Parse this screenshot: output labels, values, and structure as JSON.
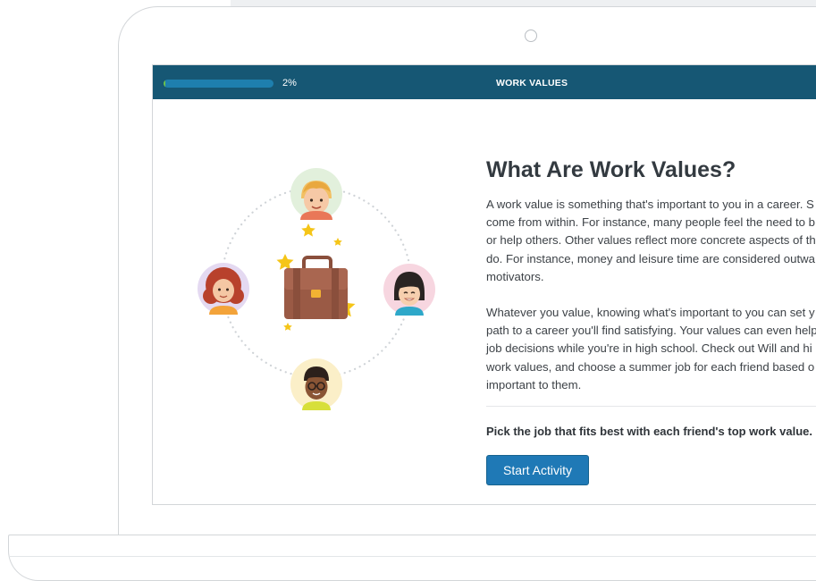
{
  "header": {
    "progress_percent": 2,
    "progress_label": "2%",
    "module_title": "WORK VALUES"
  },
  "main": {
    "title": "What Are Work Values?",
    "paragraph_1": "A work value is something that's important to you in a career. S\ncome from within. For instance, many people feel the need to b\nor help others. Other values reflect more concrete aspects of th\ndo. For instance, money and leisure time are considered outwa\nmotivators.",
    "paragraph_2": "Whatever you value, knowing what's important to you can set y\npath to a career you'll find satisfying. Your values can even help\njob decisions while you're in high school. Check out Will and hi\nwork values, and choose a summer job for each friend based o\nimportant to them.",
    "instruction": "Pick the job that fits best with each friend's top work value.",
    "start_button_label": "Start Activity"
  },
  "colors": {
    "header_bg": "#165774",
    "progress_track": "#1e7fae",
    "progress_fill": "#6cc24a",
    "button_bg": "#1f79b6",
    "briefcase": "#9a5a45",
    "star": "#f5c518"
  },
  "illustration": {
    "icons": [
      "avatar-blond-boy-icon",
      "avatar-red-hair-girl-icon",
      "avatar-dark-hair-girl-icon",
      "avatar-glasses-boy-icon",
      "briefcase-icon",
      "star-icon"
    ]
  }
}
